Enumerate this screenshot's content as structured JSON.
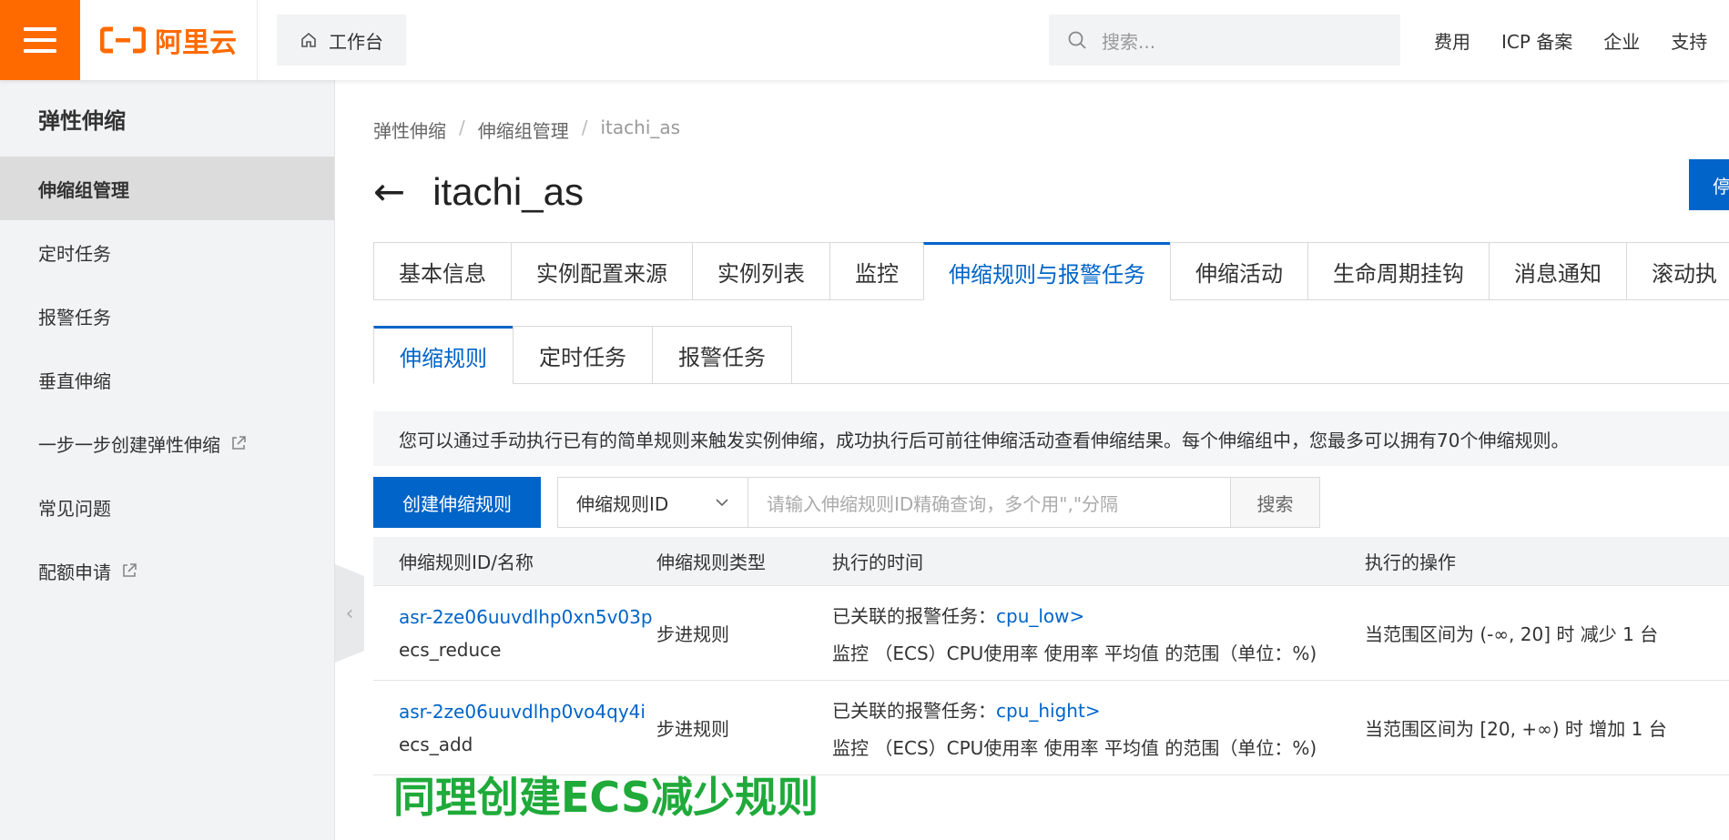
{
  "topbar": {
    "logo_text": "阿里云",
    "workbench_label": "工作台",
    "search_placeholder": "搜索...",
    "links": [
      "费用",
      "ICP 备案",
      "企业",
      "支持"
    ],
    "brand_color": "#ff6a00"
  },
  "sidebar": {
    "title": "弹性伸缩",
    "items": [
      {
        "label": "伸缩组管理",
        "active": true
      },
      {
        "label": "定时任务"
      },
      {
        "label": "报警任务"
      },
      {
        "label": "垂直伸缩"
      },
      {
        "label": "一步一步创建弹性伸缩",
        "external": true
      },
      {
        "label": "常见问题"
      },
      {
        "label": "配额申请",
        "external": true
      }
    ]
  },
  "breadcrumb": [
    "弹性伸缩",
    "伸缩组管理",
    "itachi_as"
  ],
  "page_title": "itachi_as",
  "stop_button": "停",
  "tabs": [
    "基本信息",
    "实例配置来源",
    "实例列表",
    "监控",
    "伸缩规则与报警任务",
    "伸缩活动",
    "生命周期挂钩",
    "消息通知",
    "滚动执"
  ],
  "active_tab": "伸缩规则与报警任务",
  "subtabs": [
    "伸缩规则",
    "定时任务",
    "报警任务"
  ],
  "notice": "您可以通过手动执行已有的简单规则来触发实例伸缩，成功执行后可前往伸缩活动查看伸缩结果。每个伸缩组中，您最多可以拥有70个伸缩规则。",
  "toolbar": {
    "create_button": "创建伸缩规则",
    "select_value": "伸缩规则ID",
    "input_placeholder": "请输入伸缩规则ID精确查询，多个用\",\"分隔",
    "search_button": "搜索"
  },
  "table": {
    "headers": [
      "伸缩规则ID/名称",
      "伸缩规则类型",
      "执行的时间",
      "执行的操作"
    ],
    "rows": [
      {
        "id": "asr-2ze06uuvdlhp0xn5v03p",
        "name": "ecs_reduce",
        "type": "步进规则",
        "alarm_prefix": "已关联的报警任务：",
        "alarm_link": "cpu_low>",
        "monitor": "监控 （ECS）CPU使用率 使用率 平均值 的范围（单位：%)",
        "action": "当范围区间为 (-∞, 20] 时 减少 1 台"
      },
      {
        "id": "asr-2ze06uuvdlhp0vo4qy4i",
        "name": "ecs_add",
        "type": "步进规则",
        "alarm_prefix": "已关联的报警任务：",
        "alarm_link": "cpu_hight>",
        "monitor": "监控 （ECS）CPU使用率 使用率 平均值 的范围（单位：%)",
        "action": "当范围区间为 [20, +∞) 时 增加 1 台"
      }
    ]
  },
  "annotation": "同理创建ECS减少规则"
}
